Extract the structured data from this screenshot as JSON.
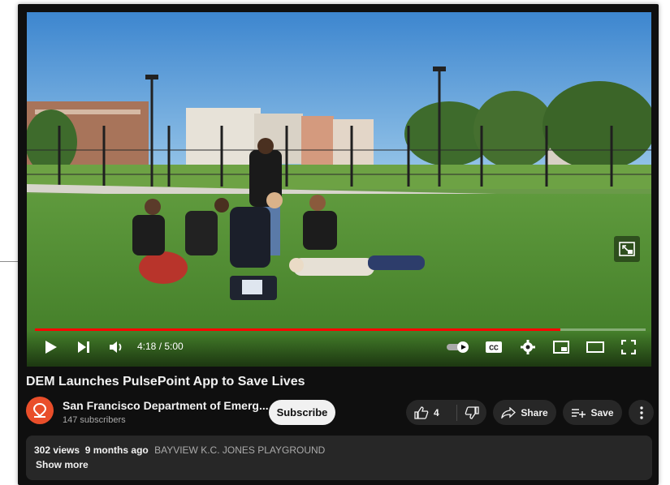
{
  "video": {
    "current_time": "4:18",
    "separator": " / ",
    "duration": "5:00",
    "progress": 0.86
  },
  "title": "DEM Launches PulsePoint App to Save Lives",
  "channel": {
    "name": "San Francisco Department of Emerg...",
    "subscribers": "147 subscribers",
    "subscribe_label": "Subscribe",
    "avatar_color": "#e94e2a"
  },
  "actions": {
    "like_count": "4",
    "share_label": "Share",
    "save_label": "Save"
  },
  "description": {
    "views": "302 views",
    "age": "9 months ago",
    "location": "BAYVIEW K.C. JONES PLAYGROUND",
    "show_more": "Show more"
  },
  "icons": {
    "play": "play-icon",
    "next": "next-icon",
    "volume": "volume-icon",
    "autoplay": "autoplay-toggle-icon",
    "cc": "captions-icon",
    "settings": "gear-icon",
    "miniplayer": "miniplayer-icon",
    "theater": "theater-icon",
    "fullscreen": "fullscreen-icon",
    "pip": "picture-in-picture-icon",
    "like": "thumbs-up-icon",
    "dislike": "thumbs-down-icon",
    "share": "share-icon",
    "save": "save-playlist-icon",
    "more": "more-vert-icon"
  },
  "colors": {
    "progress_played": "#ff0000",
    "background": "#0f0f0f",
    "pill": "#272727"
  }
}
